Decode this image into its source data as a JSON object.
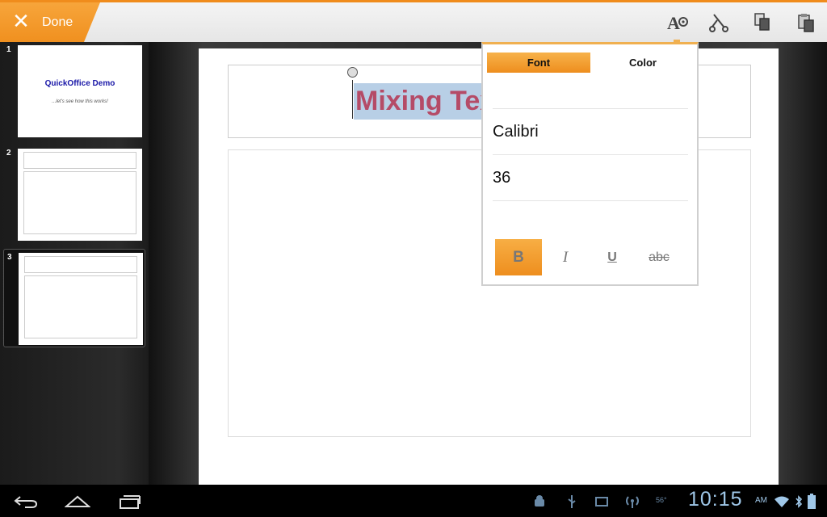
{
  "colors": {
    "accent": "#f08c1c",
    "selection_text": "#b54b67",
    "selection_bg": "#b8cfe6",
    "status_icons": "#6a8aa8",
    "clock": "#9fc7e8"
  },
  "toolbar": {
    "done_label": "Done",
    "icons": [
      "text-format-icon",
      "cut-icon",
      "copy-icon",
      "paste-icon"
    ]
  },
  "slides": [
    {
      "number": "1",
      "title": "QuickOffice Demo",
      "subtitle": "...let's see how this works!"
    },
    {
      "number": "2"
    },
    {
      "number": "3"
    }
  ],
  "editor": {
    "title_text": "Mixing Text"
  },
  "popup": {
    "tabs": [
      "Font",
      "Color"
    ],
    "active_tab": "Font",
    "font_name": "Calibri",
    "font_size": "36",
    "format_buttons": {
      "bold": "B",
      "italic": "I",
      "underline": "U",
      "strike": "abc"
    }
  },
  "status": {
    "time": "10:15",
    "ampm": "AM",
    "temperature": "56°"
  }
}
